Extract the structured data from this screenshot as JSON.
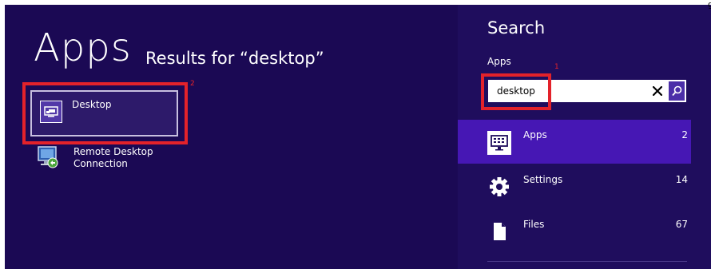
{
  "apps": {
    "title": "Apps",
    "subtitle": "Results for “desktop”",
    "results": [
      {
        "label": "Desktop",
        "icon": "desktop-icon",
        "selected": true
      },
      {
        "label": "Remote Desktop\nConnection",
        "icon": "remote-desktop-connection-icon",
        "selected": false
      }
    ]
  },
  "search": {
    "title": "Search",
    "scope_label": "Apps",
    "query": "desktop",
    "clear_icon": "close-icon",
    "go_icon": "search-icon",
    "categories": [
      {
        "label": "Apps",
        "count": "2",
        "icon": "apps-icon",
        "selected": true
      },
      {
        "label": "Settings",
        "count": "14",
        "icon": "gear-icon",
        "selected": false
      },
      {
        "label": "Files",
        "count": "67",
        "icon": "file-icon",
        "selected": false
      }
    ]
  },
  "annotations": {
    "step1": "1",
    "step2": "2"
  },
  "corner_text": "g",
  "colors": {
    "apps_background": "#1b0954",
    "search_background": "#1f0d5d",
    "selected_category": "#4617b4",
    "accent": "#4b2ea8",
    "annotation_red": "#e3222a"
  }
}
